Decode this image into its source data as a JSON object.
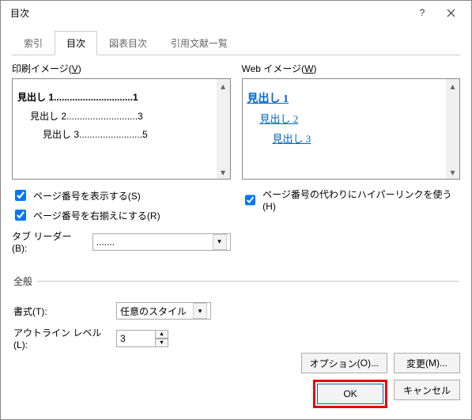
{
  "title": "目次",
  "tabs": [
    "索引",
    "目次",
    "図表目次",
    "引用文献一覧"
  ],
  "active_tab": 1,
  "left": {
    "label": "印刷イメージ",
    "key": "V",
    "lines": [
      {
        "text": "見出し 1",
        "dots": "..............................",
        "page": "1",
        "indent": 0,
        "bold": true
      },
      {
        "text": "見出し 2",
        "dots": "...........................",
        "page": "3",
        "indent": 1,
        "bold": false
      },
      {
        "text": "見出し 3",
        "dots": "........................",
        "page": "5",
        "indent": 2,
        "bold": false
      }
    ]
  },
  "right": {
    "label": "Web イメージ",
    "key": "W",
    "lines": [
      {
        "text": "見出し 1",
        "indent": 0,
        "bold": true
      },
      {
        "text": "見出し 2",
        "indent": 1,
        "bold": false
      },
      {
        "text": "見出し 3",
        "indent": 2,
        "bold": false
      }
    ]
  },
  "chk_show_page": {
    "label": "ページ番号を表示する",
    "key": "S",
    "checked": true
  },
  "chk_right_align": {
    "label": "ページ番号を右揃えにする",
    "key": "R",
    "checked": true
  },
  "chk_hyperlink": {
    "label": "ページ番号の代わりにハイパーリンクを使う",
    "key": "H",
    "checked": true
  },
  "tab_leader": {
    "label": "タブ リーダー",
    "key": "B",
    "value": "......."
  },
  "general_label": "全般",
  "format": {
    "label": "書式",
    "key": "T",
    "value": "任意のスタイル"
  },
  "outline": {
    "label": "アウトライン レベル",
    "key": "L",
    "value": "3"
  },
  "btn_options": {
    "label": "オプション",
    "key": "O"
  },
  "btn_modify": {
    "label": "変更",
    "key": "M"
  },
  "btn_ok": "OK",
  "btn_cancel": "キャンセル"
}
